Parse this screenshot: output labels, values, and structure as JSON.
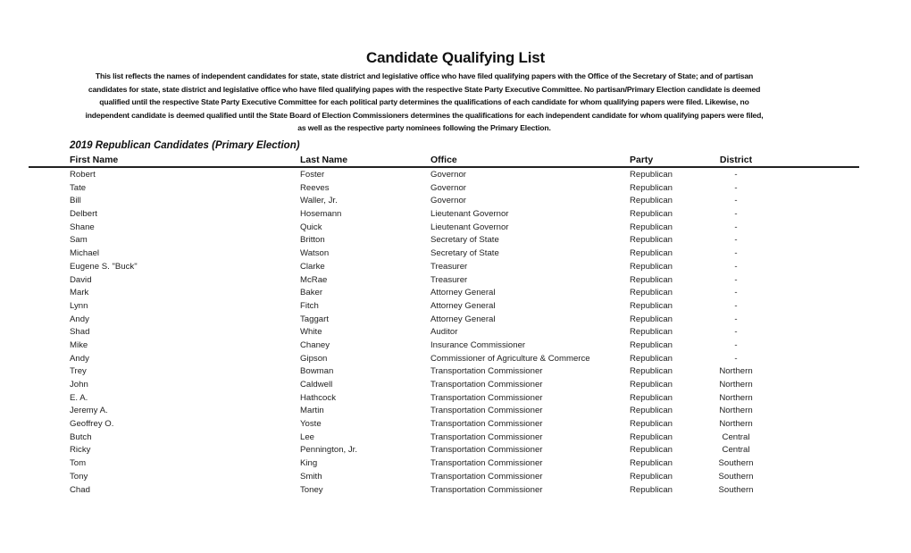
{
  "document": {
    "title": "Candidate Qualifying List",
    "intro_lines": [
      "This list reflects the names of independent candidates for state, state district and legislative office who have filed qualifying papers with the Office of the Secretary of State; and of partisan",
      "candidates for state, state district and legislative office who have filed qualifying papes with the respective State Party Executive Committee.  No partisan/Primary Election candidate is deemed",
      "qualified until the respective State Party Executive Committee for each political party determines the qualifications of each candidate for whom qualifying papers were filed.  Likewise, no",
      "independent candidate is deemed qualified until the State Board of Election Commissioners determines the qualifications for each independent candidate for whom qualifying papers were filed,",
      "as well as the respective party nominees following the Primary Election."
    ],
    "section_title": "2019 Republican Candidates (Primary Election)"
  },
  "table": {
    "headers": {
      "first_name": "First Name",
      "last_name": "Last Name",
      "office": "Office",
      "party": "Party",
      "district": "District"
    },
    "rows": [
      {
        "first_name": "Robert",
        "last_name": "Foster",
        "office": "Governor",
        "party": "Republican",
        "district": "-"
      },
      {
        "first_name": "Tate",
        "last_name": "Reeves",
        "office": "Governor",
        "party": "Republican",
        "district": "-"
      },
      {
        "first_name": "Bill",
        "last_name": "Waller, Jr.",
        "office": "Governor",
        "party": "Republican",
        "district": "-"
      },
      {
        "first_name": "Delbert",
        "last_name": "Hosemann",
        "office": "Lieutenant Governor",
        "party": "Republican",
        "district": "-"
      },
      {
        "first_name": "Shane",
        "last_name": "Quick",
        "office": "Lieutenant Governor",
        "party": "Republican",
        "district": "-"
      },
      {
        "first_name": "Sam",
        "last_name": "Britton",
        "office": "Secretary of State",
        "party": "Republican",
        "district": "-"
      },
      {
        "first_name": "Michael",
        "last_name": "Watson",
        "office": "Secretary of State",
        "party": "Republican",
        "district": "-"
      },
      {
        "first_name": "Eugene S. \"Buck\"",
        "last_name": "Clarke",
        "office": "Treasurer",
        "party": "Republican",
        "district": "-"
      },
      {
        "first_name": "David",
        "last_name": "McRae",
        "office": "Treasurer",
        "party": "Republican",
        "district": "-"
      },
      {
        "first_name": "Mark",
        "last_name": "Baker",
        "office": "Attorney General",
        "party": "Republican",
        "district": "-"
      },
      {
        "first_name": "Lynn",
        "last_name": "Fitch",
        "office": "Attorney General",
        "party": "Republican",
        "district": "-"
      },
      {
        "first_name": "Andy",
        "last_name": "Taggart",
        "office": "Attorney General",
        "party": "Republican",
        "district": "-"
      },
      {
        "first_name": "Shad",
        "last_name": "White",
        "office": "Auditor",
        "party": "Republican",
        "district": "-"
      },
      {
        "first_name": "Mike",
        "last_name": "Chaney",
        "office": "Insurance Commissioner",
        "party": "Republican",
        "district": "-"
      },
      {
        "first_name": "Andy",
        "last_name": "Gipson",
        "office": "Commissioner of Agriculture & Commerce",
        "party": "Republican",
        "district": "-"
      },
      {
        "first_name": "Trey",
        "last_name": "Bowman",
        "office": "Transportation Commissioner",
        "party": "Republican",
        "district": "Northern"
      },
      {
        "first_name": "John",
        "last_name": "Caldwell",
        "office": "Transportation Commissioner",
        "party": "Republican",
        "district": "Northern"
      },
      {
        "first_name": "E. A.",
        "last_name": "Hathcock",
        "office": "Transportation Commissioner",
        "party": "Republican",
        "district": "Northern"
      },
      {
        "first_name": "Jeremy A.",
        "last_name": "Martin",
        "office": "Transportation Commissioner",
        "party": "Republican",
        "district": "Northern"
      },
      {
        "first_name": "Geoffrey O.",
        "last_name": "Yoste",
        "office": "Transportation Commissioner",
        "party": "Republican",
        "district": "Northern"
      },
      {
        "first_name": "Butch",
        "last_name": "Lee",
        "office": "Transportation Commissioner",
        "party": "Republican",
        "district": "Central"
      },
      {
        "first_name": "Ricky",
        "last_name": "Pennington, Jr.",
        "office": "Transportation Commissioner",
        "party": "Republican",
        "district": "Central"
      },
      {
        "first_name": "Tom",
        "last_name": "King",
        "office": "Transportation Commissioner",
        "party": "Republican",
        "district": "Southern"
      },
      {
        "first_name": "Tony",
        "last_name": "Smith",
        "office": "Transportation Commissioner",
        "party": "Republican",
        "district": "Southern"
      },
      {
        "first_name": "Chad",
        "last_name": "Toney",
        "office": "Transportation Commissioner",
        "party": "Republican",
        "district": "Southern"
      }
    ]
  }
}
